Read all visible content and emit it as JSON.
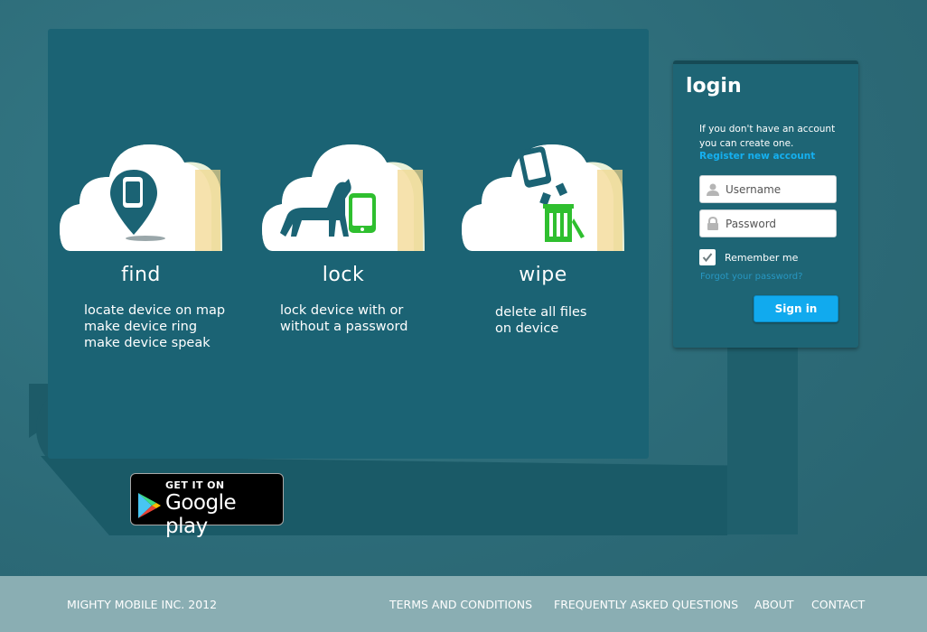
{
  "features": [
    {
      "title": "find",
      "lines": [
        "locate device on map",
        "make device ring",
        "make device speak"
      ],
      "icon": "map-pin-phone-icon"
    },
    {
      "title": "lock",
      "lines": [
        "lock device with or",
        "without a password"
      ],
      "icon": "dog-phone-icon"
    },
    {
      "title": "wipe",
      "lines": [
        "delete all files",
        "on device"
      ],
      "icon": "trash-phone-icon"
    }
  ],
  "login": {
    "title": "login",
    "info_lines": [
      "If you don't have an account",
      "you can create one."
    ],
    "register_link": "Register new account",
    "username_placeholder": "Username",
    "password_placeholder": "Password",
    "remember_label": "Remember me",
    "remember_checked": true,
    "forgot_link": "Forgot your password?",
    "signin_label": "Sign in"
  },
  "google_play": {
    "small_text": "GET IT ON",
    "big_text": "Google play"
  },
  "footer": {
    "copyright": "MIGHTY MOBILE INC. 2012",
    "nav": [
      "TERMS AND CONDITIONS",
      "FREQUENTLY ASKED QUESTIONS",
      "ABOUT",
      "CONTACT"
    ]
  },
  "colors": {
    "accent": "#11aaee",
    "panel": "#1b6374",
    "footer": "#8aaeb3",
    "green": "#2fbf2f"
  }
}
